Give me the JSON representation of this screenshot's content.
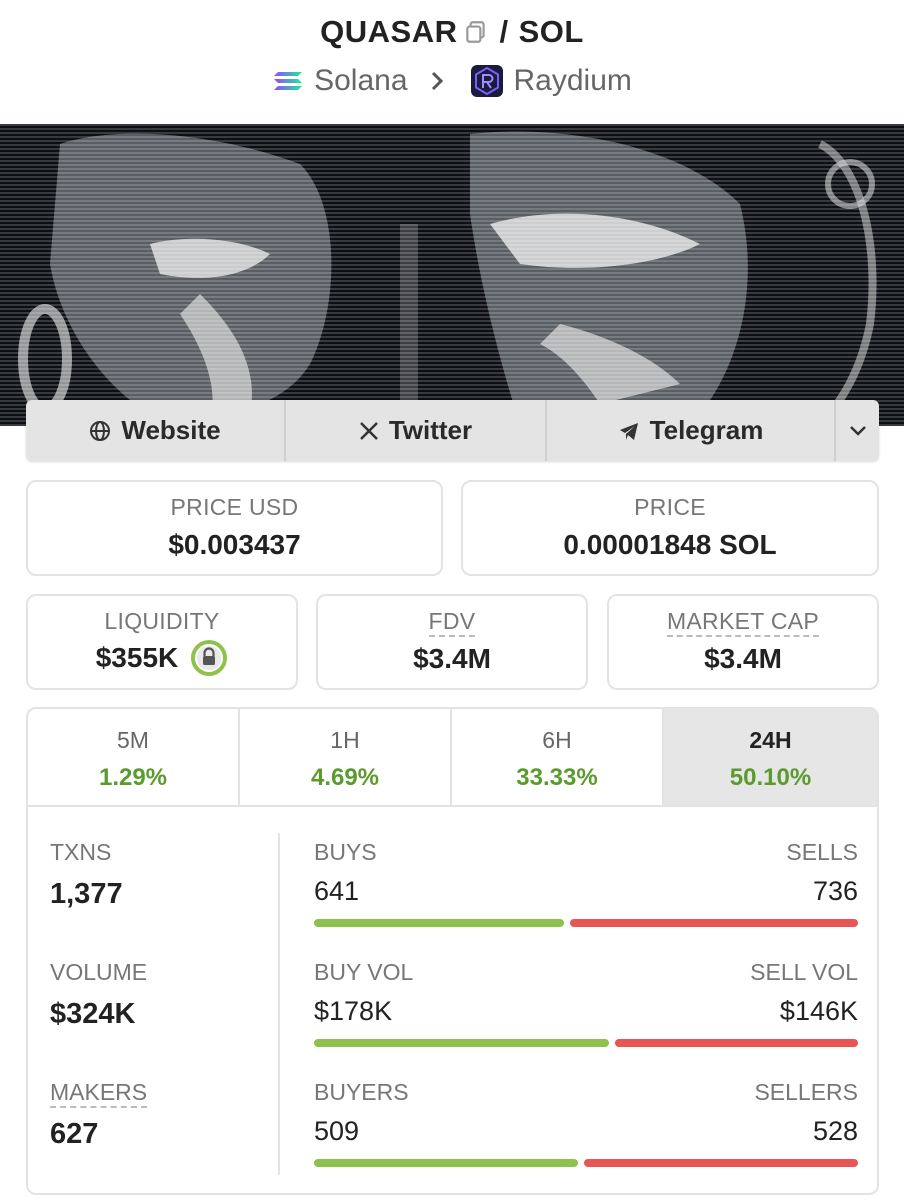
{
  "header": {
    "base_token": "QUASAR",
    "slash": "/",
    "quote_token": "SOL",
    "chain": "Solana",
    "dex": "Raydium"
  },
  "links": {
    "website": "Website",
    "twitter": "Twitter",
    "telegram": "Telegram"
  },
  "price": {
    "usd_label": "PRICE USD",
    "usd_value": "$0.003437",
    "native_label": "PRICE",
    "native_value": "0.00001848 SOL"
  },
  "metrics": {
    "liquidity_label": "LIQUIDITY",
    "liquidity_value": "$355K",
    "fdv_label": "FDV",
    "fdv_value": "$3.4M",
    "mcap_label": "MARKET CAP",
    "mcap_value": "$3.4M"
  },
  "tabs": [
    {
      "label": "5M",
      "value": "1.29%"
    },
    {
      "label": "1H",
      "value": "4.69%"
    },
    {
      "label": "6H",
      "value": "33.33%"
    },
    {
      "label": "24H",
      "value": "50.10%"
    }
  ],
  "active_tab": "24H",
  "stats": {
    "txns_label": "TXNS",
    "txns_value": "1,377",
    "volume_label": "VOLUME",
    "volume_value": "$324K",
    "makers_label": "MAKERS",
    "makers_value": "627",
    "buys_label": "BUYS",
    "buys_value": "641",
    "sells_label": "SELLS",
    "sells_value": "736",
    "buyvol_label": "BUY VOL",
    "buyvol_value": "$178K",
    "sellvol_label": "SELL VOL",
    "sellvol_value": "$146K",
    "buyers_label": "BUYERS",
    "buyers_value": "509",
    "sellers_label": "SELLERS",
    "sellers_value": "528"
  },
  "ratios": {
    "buys_share": 0.4655,
    "buyvol_share": 0.549,
    "buyers_share": 0.4908
  },
  "colors": {
    "positive": "#5b9a2c",
    "buy_bar": "#8ec24d",
    "sell_bar": "#e85555"
  },
  "icons": [
    "copy-icon",
    "solana-icon",
    "chevron-right-icon",
    "raydium-icon",
    "globe-icon",
    "x-icon",
    "telegram-icon",
    "chevron-down-icon",
    "lock-icon"
  ]
}
